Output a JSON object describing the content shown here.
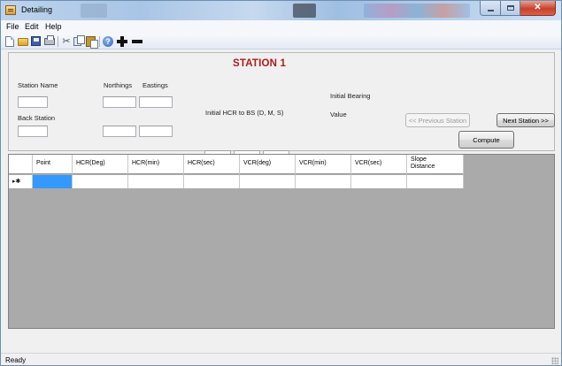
{
  "window": {
    "title": "Detailing"
  },
  "menu": {
    "items": [
      "File",
      "Edit",
      "Help"
    ]
  },
  "toolbar": {
    "icons": [
      "new-document-icon",
      "open-folder-icon",
      "save-icon",
      "print-icon",
      "cut-icon",
      "copy-icon",
      "paste-icon",
      "help-icon",
      "add-icon",
      "remove-icon"
    ]
  },
  "form": {
    "station_title": "STATION 1",
    "station_name_label": "Station Name",
    "back_station_label": "Back Station",
    "northings_label": "Northings",
    "eastings_label": "Eastings",
    "initial_hcr_label": "Initial HCR to BS (D, M, S)",
    "initial_bearing_label": "Initial Bearing",
    "value_label": "Value",
    "previous_button": "<< Previous Station",
    "next_button": "Next Station >>",
    "compute_button": "Compute"
  },
  "grid": {
    "columns": [
      "Point",
      "HCR(Deg)",
      "HCR(min)",
      "HCR(sec)",
      "VCR(deg)",
      "VCR(min)",
      "VCR(sec)",
      "Slope Distance"
    ],
    "new_row_marker": "▸✱"
  },
  "status": {
    "text": "Ready"
  }
}
